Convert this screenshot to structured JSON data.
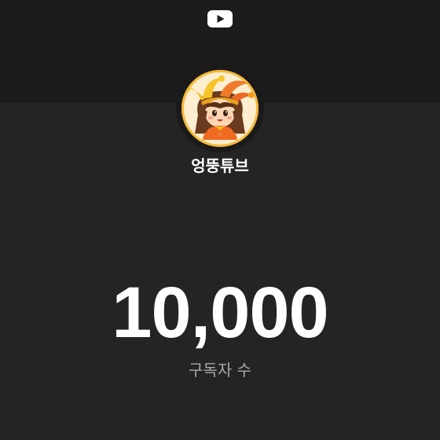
{
  "header": {
    "logo_icon": "youtube-play-icon"
  },
  "channel": {
    "avatar_icon": "jester-girl-avatar",
    "name": "엉뚱튜브"
  },
  "stats": {
    "subscriber_count": "10,000",
    "subscriber_label": "구독자 수"
  },
  "colors": {
    "background": "#242424",
    "top_band": "#1c1c1c",
    "text_primary": "#ffffff",
    "text_secondary": "#a8a8a8"
  }
}
